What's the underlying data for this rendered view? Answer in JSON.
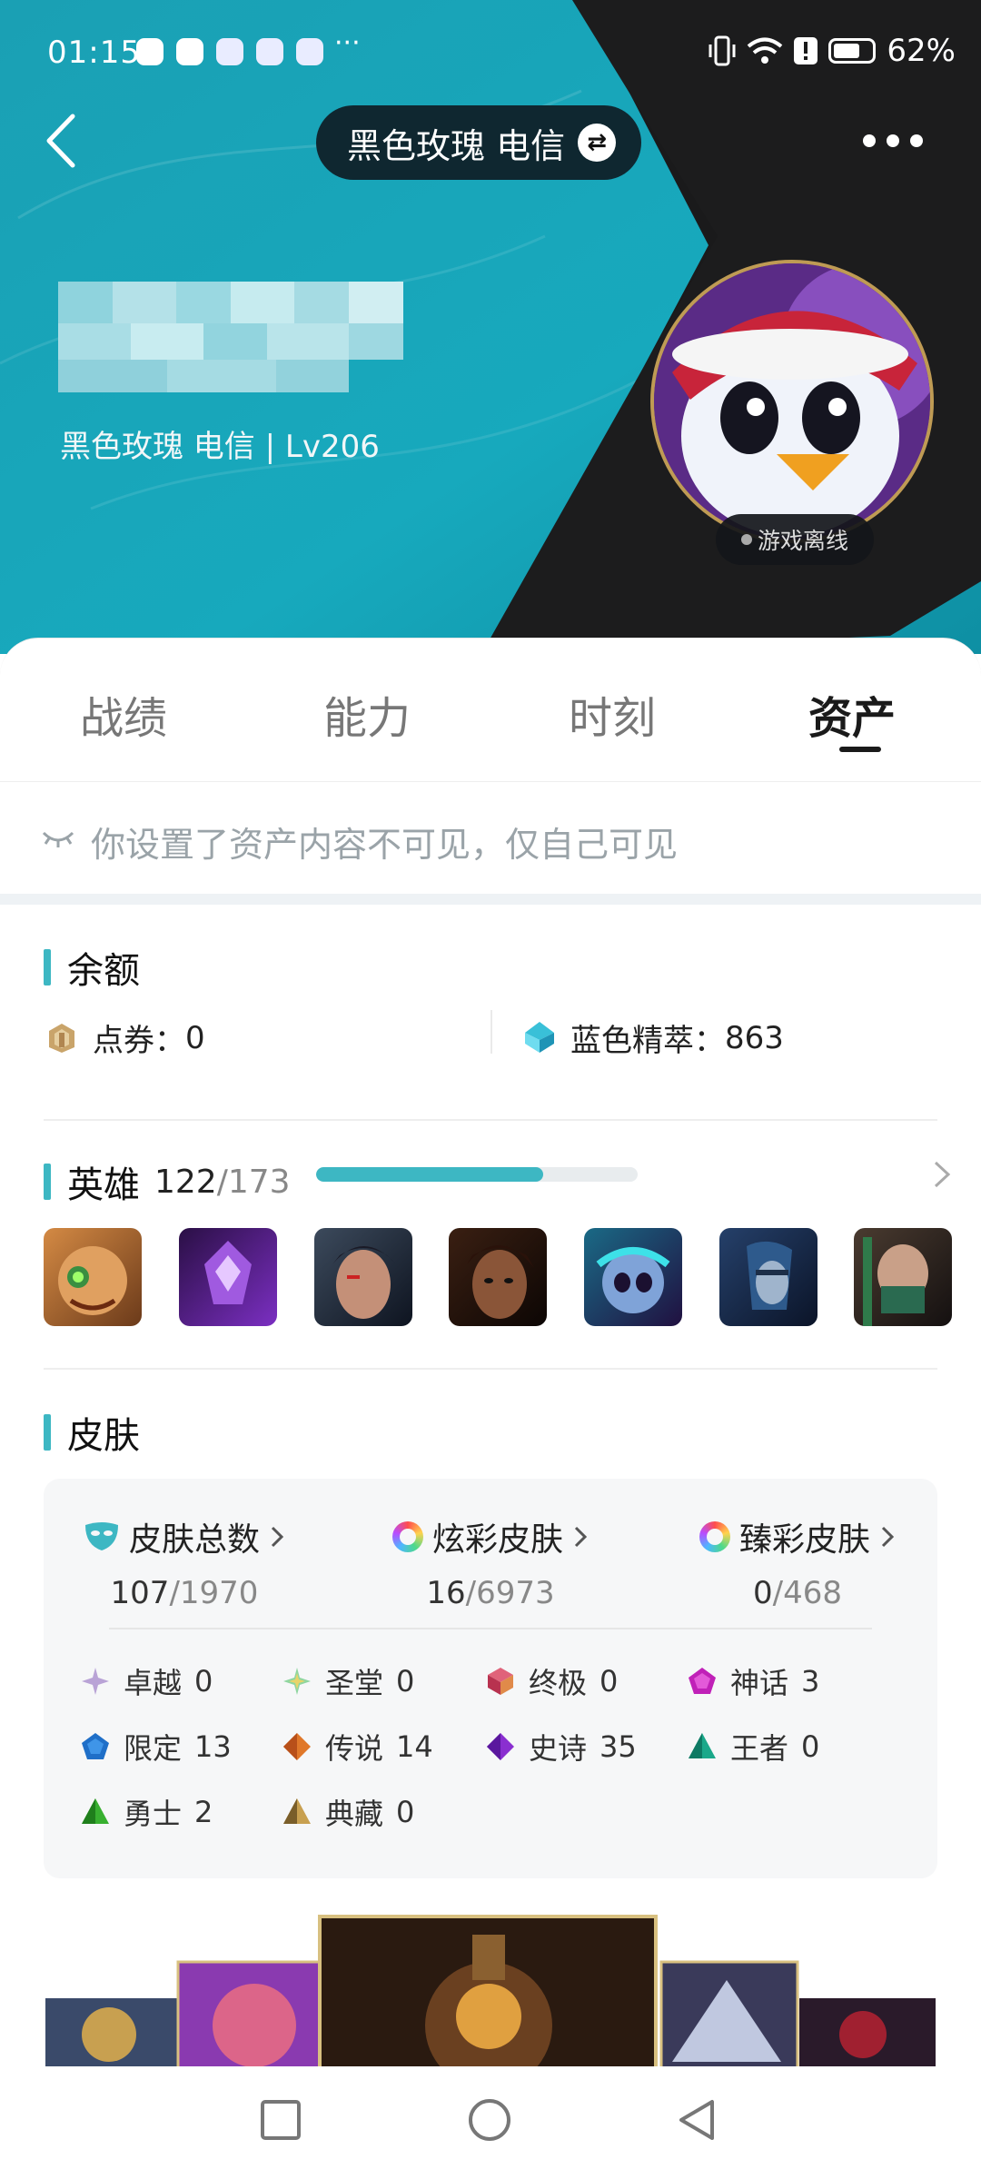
{
  "status": {
    "time": "01:15",
    "battery": "62%",
    "overflow": "···"
  },
  "header": {
    "server_name": "黑色玫瑰 电信",
    "swap_icon": "swap-arrows-icon",
    "subtitle": "黑色玫瑰 电信 | Lv206",
    "status_badge": "游戏离线"
  },
  "tabs": [
    {
      "label": "战绩",
      "active": false
    },
    {
      "label": "能力",
      "active": false
    },
    {
      "label": "时刻",
      "active": false
    },
    {
      "label": "资产",
      "active": true
    }
  ],
  "notice": {
    "text": "你设置了资产内容不可见，仅自己可见",
    "icon": "eye-closed-icon"
  },
  "balance": {
    "title": "余额",
    "rp_label": "点券：",
    "rp_value": "0",
    "be_label": "蓝色精萃：",
    "be_value": "863"
  },
  "heroes": {
    "title": "英雄",
    "owned": "122",
    "total": "/173",
    "progress_fraction": 0.705,
    "champions": [
      "champion-1",
      "champion-2",
      "champion-3",
      "champion-4",
      "champion-5",
      "champion-6",
      "champion-7"
    ]
  },
  "skins": {
    "title": "皮肤",
    "categories": [
      {
        "label": "皮肤总数",
        "owned": "107",
        "total": "/1970"
      },
      {
        "label": "炫彩皮肤",
        "owned": "16",
        "total": "/6973"
      },
      {
        "label": "臻彩皮肤",
        "owned": "0",
        "total": "/468"
      }
    ],
    "tiers": [
      {
        "label": "卓越",
        "value": "0"
      },
      {
        "label": "圣堂",
        "value": "0"
      },
      {
        "label": "终极",
        "value": "0"
      },
      {
        "label": "神话",
        "value": "3"
      },
      {
        "label": "限定",
        "value": "13"
      },
      {
        "label": "传说",
        "value": "14"
      },
      {
        "label": "史诗",
        "value": "35"
      },
      {
        "label": "王者",
        "value": "0"
      },
      {
        "label": "勇士",
        "value": "2"
      },
      {
        "label": "典藏",
        "value": "0"
      }
    ]
  },
  "colors": {
    "accent": "#3db7c3",
    "hero_teal": "#1fa3b6",
    "dark": "#1a1a1a"
  }
}
